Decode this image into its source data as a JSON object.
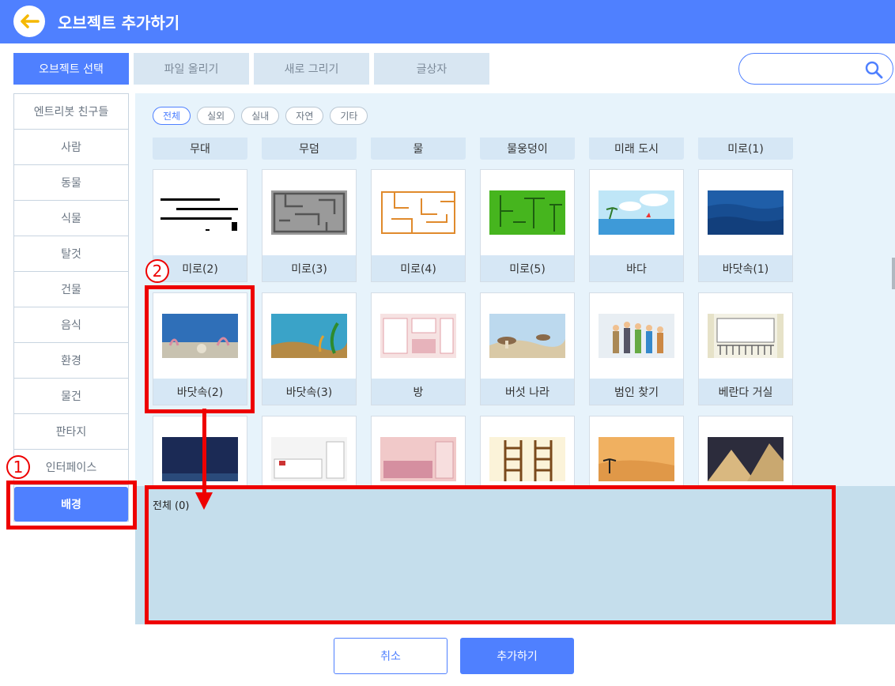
{
  "header": {
    "title": "오브젝트 추가하기"
  },
  "tabs": [
    "오브젝트 선택",
    "파일 올리기",
    "새로 그리기",
    "글상자"
  ],
  "search": {
    "placeholder": ""
  },
  "sidebar": [
    "엔트리봇 친구들",
    "사람",
    "동물",
    "식물",
    "탈것",
    "건물",
    "음식",
    "환경",
    "물건",
    "판타지",
    "인터페이스",
    "배경"
  ],
  "chips": [
    "전체",
    "실외",
    "실내",
    "자연",
    "기타"
  ],
  "top_row": [
    "무대",
    "무덤",
    "물",
    "물웅덩이",
    "미래 도시",
    "미로(1)"
  ],
  "row1": [
    "미로(2)",
    "미로(3)",
    "미로(4)",
    "미로(5)",
    "바다",
    "바닷속(1)"
  ],
  "row2": [
    "바닷속(2)",
    "바닷속(3)",
    "방",
    "버섯 나라",
    "범인 찾기",
    "베란다 거실"
  ],
  "drop_area": {
    "title": "전체 (0)"
  },
  "buttons": {
    "cancel": "취소",
    "add": "추가하기"
  },
  "annotations": {
    "marker1": "1",
    "marker2": "2"
  },
  "colors": {
    "primary": "#4f80ff",
    "highlight": "#ee0000",
    "panel": "#e7f3fb",
    "drop": "#c5deec"
  }
}
